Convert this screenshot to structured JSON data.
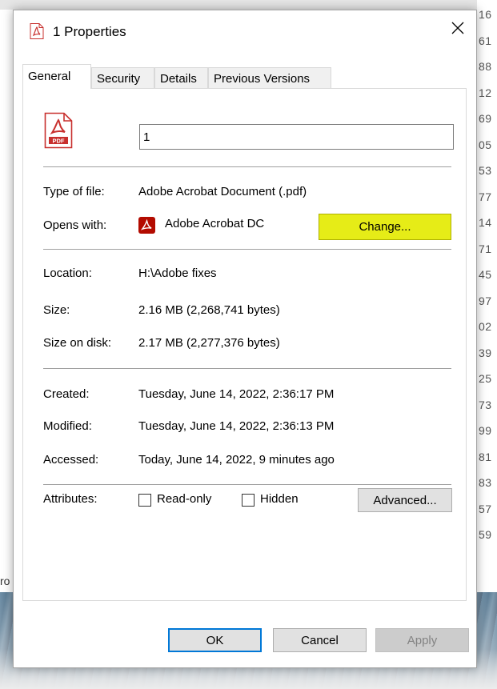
{
  "dialog": {
    "title": "1 Properties",
    "close_symbol": "✕"
  },
  "tabs": [
    {
      "label": "General",
      "active": true
    },
    {
      "label": "Security",
      "active": false
    },
    {
      "label": "Details",
      "active": false
    },
    {
      "label": "Previous Versions",
      "active": false
    }
  ],
  "general": {
    "file_name": "1",
    "type_label": "Type of file:",
    "type_value": "Adobe Acrobat Document (.pdf)",
    "opens_label": "Opens with:",
    "opens_value": "Adobe Acrobat DC",
    "change_button": "Change...",
    "location_label": "Location:",
    "location_value": "H:\\Adobe fixes",
    "size_label": "Size:",
    "size_value": "2.16 MB (2,268,741 bytes)",
    "size_disk_label": "Size on disk:",
    "size_disk_value": "2.17 MB (2,277,376 bytes)",
    "created_label": "Created:",
    "created_value": "Tuesday, June 14, 2022, 2:36:17 PM",
    "modified_label": "Modified:",
    "modified_value": "Tuesday, June 14, 2022, 2:36:13 PM",
    "accessed_label": "Accessed:",
    "accessed_value": "Today, June 14, 2022, 9 minutes ago",
    "attributes_label": "Attributes:",
    "readonly_label": "Read-only",
    "readonly_checked": false,
    "hidden_label": "Hidden",
    "hidden_checked": false,
    "advanced_button": "Advanced..."
  },
  "footer": {
    "ok": "OK",
    "cancel": "Cancel",
    "apply": "Apply"
  },
  "background": {
    "side_numbers": [
      "16",
      "61",
      "88",
      "12",
      "69",
      "05",
      "53",
      "77",
      "14",
      "71",
      "45",
      "97",
      "02",
      "39",
      "25",
      "73",
      "99",
      "81",
      "83",
      "57",
      "59"
    ],
    "left_fragment": "ro"
  },
  "colors": {
    "highlight": "#e6ec17",
    "acrobat_red": "#b30b00",
    "default_button_border": "#0078d7"
  }
}
